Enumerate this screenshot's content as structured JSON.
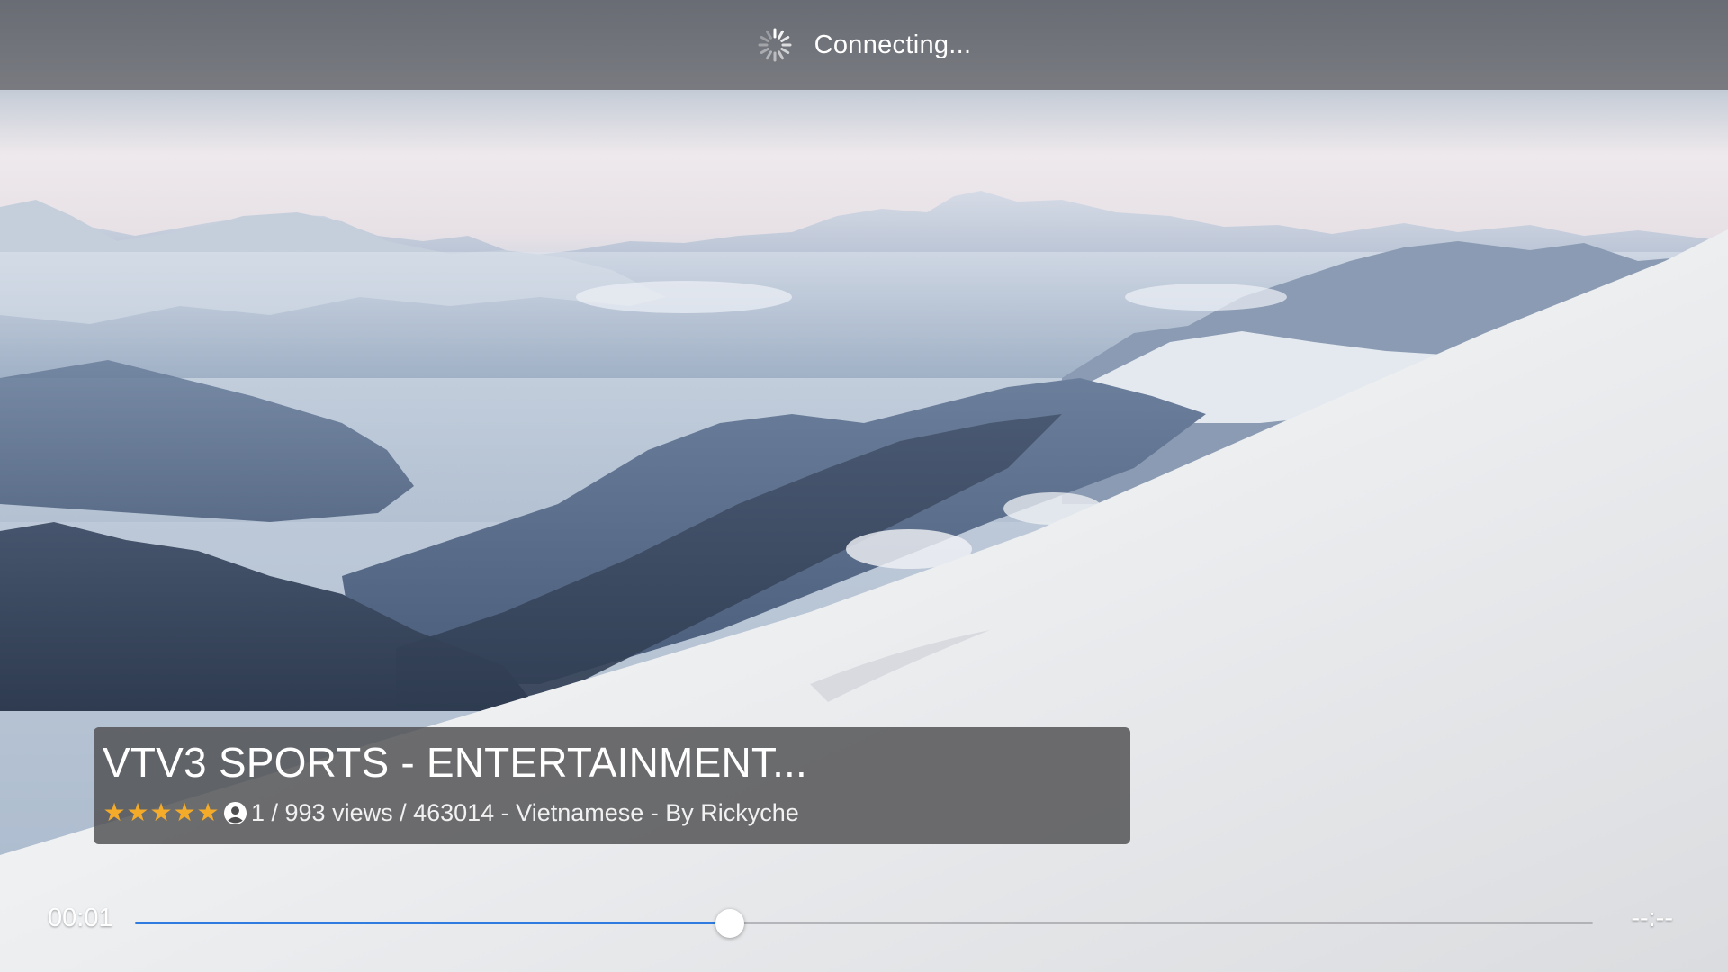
{
  "status": {
    "text": "Connecting...",
    "icon": "spinner-icon"
  },
  "channel": {
    "title": "VTV3 SPORTS - ENTERTAINMENT...",
    "rating": 5,
    "rating_max": 5,
    "rating_color": "#f5ab2a",
    "meta": "1 / 993 views / 463014 - Vietnamese - By Rickyche",
    "meta_icon": "user-icon"
  },
  "playback": {
    "elapsed": "00:01",
    "remaining": "--:--",
    "progress": 0.408,
    "accent_color": "#2f7be0"
  },
  "background": {
    "description_icon": "mountain-video-frame"
  }
}
